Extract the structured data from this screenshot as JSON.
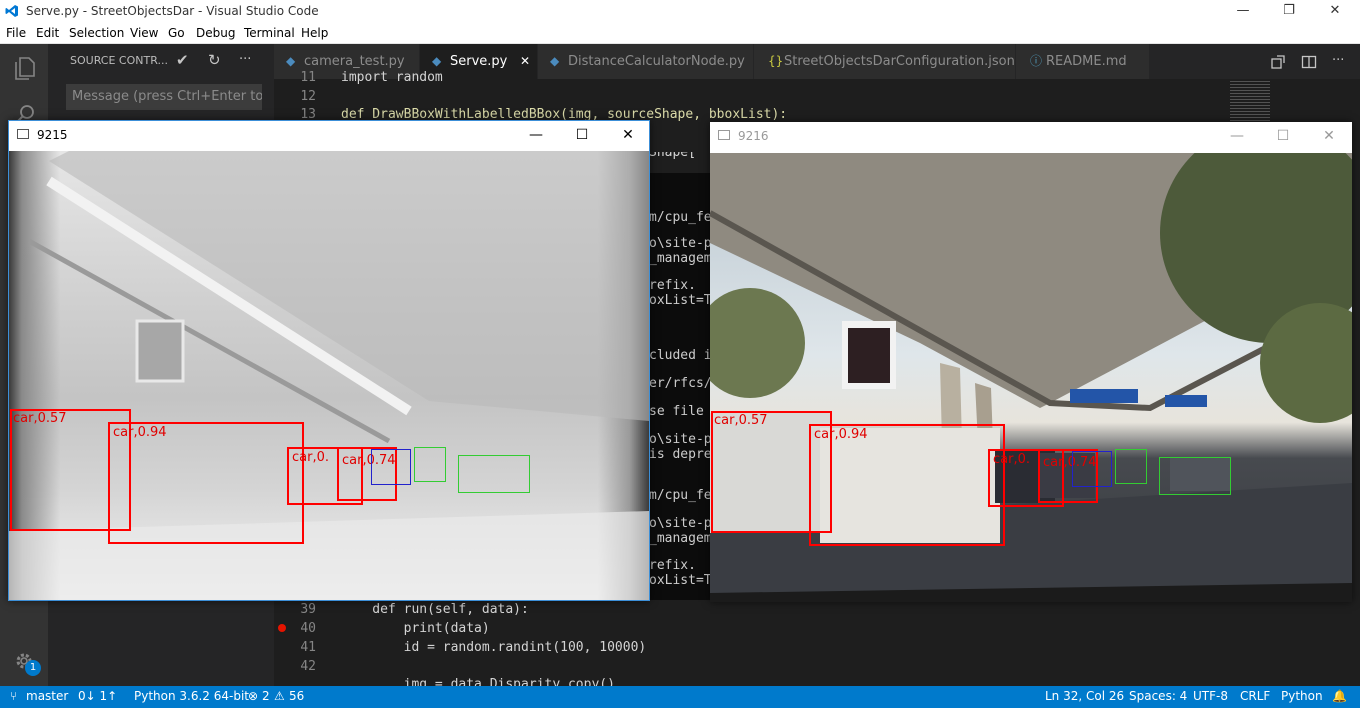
{
  "window": {
    "title": "Serve.py - StreetObjectsDar - Visual Studio Code",
    "minimize": "—",
    "maximize": "❐",
    "close": "✕"
  },
  "menu": [
    "File",
    "Edit",
    "Selection",
    "View",
    "Go",
    "Debug",
    "Terminal",
    "Help"
  ],
  "sidebar": {
    "header": "SOURCE CONTR...",
    "commit_icon": "✔",
    "refresh_icon": "↻",
    "more_icon": "···",
    "commit_placeholder": "Message (press Ctrl+Enter to"
  },
  "activity": {
    "badge": "1"
  },
  "tabs": [
    {
      "label": "camera_test.py",
      "icon": "python-icon",
      "glyph": "◆"
    },
    {
      "label": "Serve.py",
      "icon": "python-icon",
      "glyph": "◆",
      "close": "✕"
    },
    {
      "label": "DistanceCalculatorNode.py",
      "icon": "python-icon",
      "glyph": "◆"
    },
    {
      "label": "StreetObjectsDarConfiguration.json",
      "icon": "json-icon",
      "glyph": "{}"
    },
    {
      "label": "README.md",
      "icon": "info-icon",
      "glyph": "ⓘ"
    }
  ],
  "code_top": [
    {
      "ln": "11",
      "text": "import random"
    },
    {
      "ln": "12",
      "text": ""
    },
    {
      "ln": "13",
      "text": "def DrawBBoxWithLabelledBBox(img, sourceShape, bboxList):"
    }
  ],
  "code_bottom": [
    {
      "ln": "39",
      "text": "    def run(self, data):"
    },
    {
      "ln": "40",
      "text": "        print(data)"
    },
    {
      "ln": "41",
      "text": "        id = random.randint(100, 10000)"
    },
    {
      "ln": "42",
      "text": ""
    },
    {
      "ln": "",
      "text": "        img = data.Disparity.copy()"
    }
  ],
  "terminal_lines": [
    "Shape[",
    "",
    "m/cpu_fe",
    "",
    "o\\site-p",
    "_manageme",
    "",
    "refix.",
    "oxList=T",
    "",
    "",
    "cluded i",
    "",
    "er/rfcs/",
    "",
    "se file",
    "",
    "o\\site-p",
    "is depre",
    "",
    "",
    "m/cpu_fe",
    "",
    "o\\site-p",
    "_manageme",
    "",
    "refix.",
    "oxList=T"
  ],
  "window_left": {
    "title": "9215",
    "labels": [
      "car,0.57",
      "car,0.94",
      "car,0.",
      "car,0.74"
    ]
  },
  "window_right": {
    "title": "9216",
    "labels": [
      "car,0.57",
      "car,0.94",
      "car,0.",
      "car,0.74"
    ]
  },
  "statusbar": {
    "branch": "master",
    "sync": "0↓ 1↑",
    "python": "Python 3.6.2 64-bit",
    "errors": "2",
    "warnings": "56",
    "position": "Ln 32, Col 26",
    "spaces": "Spaces: 4",
    "encoding": "UTF-8",
    "eol": "CRLF",
    "language": "Python"
  },
  "colors": {
    "accent": "#007acc",
    "bbox_red": "#ff0000",
    "bbox_blue": "#2222cc",
    "bbox_green": "#33cc33"
  }
}
